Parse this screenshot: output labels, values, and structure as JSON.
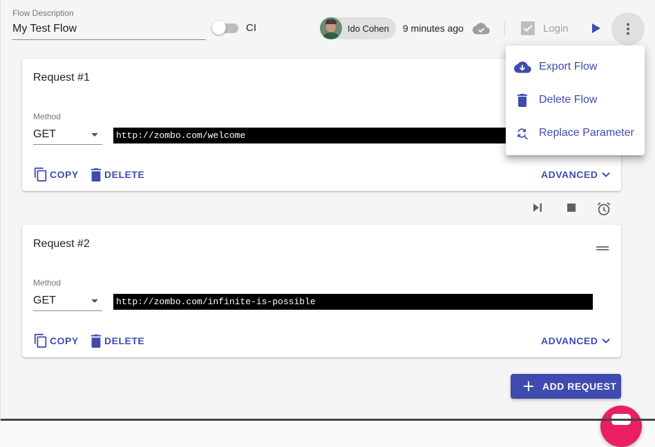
{
  "header": {
    "flow_description_label": "Flow Description",
    "flow_description_value": "My Test Flow",
    "ci_toggle_label": "CI",
    "ci_enabled": false,
    "user_name": "Ido Cohen",
    "last_saved": "9 minutes ago",
    "login_label": "Login",
    "login_checked": true
  },
  "requests": [
    {
      "title": "Request #1",
      "method_label": "Method",
      "method": "GET",
      "url": "http://zombo.com/welcome",
      "copy_label": "COPY",
      "delete_label": "DELETE",
      "advanced_label": "ADVANCED"
    },
    {
      "title": "Request #2",
      "method_label": "Method",
      "method": "GET",
      "url": "http://zombo.com/infinite-is-possible",
      "copy_label": "COPY",
      "delete_label": "DELETE",
      "advanced_label": "ADVANCED"
    }
  ],
  "add_request_label": "ADD REQUEST",
  "menu": {
    "items": [
      {
        "label": "Export Flow",
        "icon": "cloud-download-icon"
      },
      {
        "label": "Delete Flow",
        "icon": "trash-icon"
      },
      {
        "label": "Replace Parameter",
        "icon": "find-replace-icon"
      }
    ]
  },
  "colors": {
    "primary": "#3f4baf",
    "fab": "#e91e63",
    "url_background": "#000000"
  },
  "icons": [
    "cloud-done-icon",
    "checkbox-icon",
    "play-icon",
    "more-vert-icon",
    "copy-icon",
    "delete-icon",
    "expand-icon",
    "drag-handle-icon",
    "skip-next-icon",
    "stop-icon",
    "alarm-icon",
    "add-icon"
  ]
}
